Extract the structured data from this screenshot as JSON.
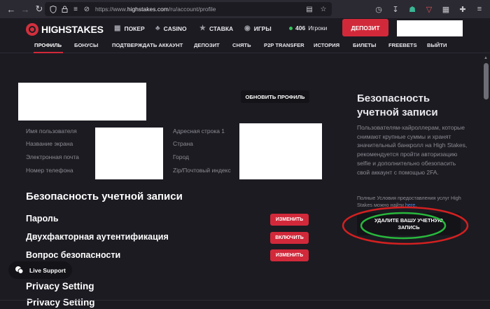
{
  "browser": {
    "url_prefix": "https://www.",
    "url_domain": "highstakes.com",
    "url_path": "/ru/account/profile"
  },
  "site": {
    "logo_text": "HIGHSTAKES",
    "nav": {
      "poker": "ПОКЕР",
      "casino": "CASINO",
      "bet": "СТАВКА",
      "games": "ИГРЫ",
      "online_count": "406",
      "online_label": "Игроки"
    },
    "deposit_button": "ДЕПОЗИТ"
  },
  "subnav": [
    "ПРОФИЛЬ",
    "БОНУСЫ",
    "ПОДТВЕРЖДАТЬ АККАУНТ",
    "ДЕПОЗИТ",
    "СНЯТЬ",
    "P2P TRANSFER",
    "ИСТОРИЯ",
    "БИЛЕТЫ",
    "FREEBETS",
    "ВЫЙТИ"
  ],
  "profile": {
    "update_button": "ОБНОВИТЬ ПРОФИЛЬ",
    "left_labels": [
      "Имя пользователя",
      "Название экрана",
      "Электронная почта",
      "Номер телефона"
    ],
    "right_labels": [
      "Адресная строка 1",
      "Страна",
      "Город",
      "Zip/Почтовый индекс"
    ]
  },
  "security": {
    "title": "Безопасность учетной записи",
    "rows": [
      {
        "label": "Пароль",
        "button": "ИЗМЕНИТЬ"
      },
      {
        "label": "Двухфакторная аутентификация",
        "button": "ВКЛЮЧИТЬ"
      },
      {
        "label": "Вопрос безопасности",
        "button": "ИЗМЕНИТЬ"
      }
    ],
    "privacy_1": "Privacy Setting",
    "privacy_2": "Privacy Setting"
  },
  "sidebar": {
    "title": "Безопасность учетной записи",
    "text": "Пользователям-хайроллерам, которые снимают крупные суммы и хранят значительный банкролл на High Stakes, рекомендуется пройти авторизацию selfie и дополнительно обезопасить свой аккаунт с помощью 2FA.",
    "small_text": "Полные Условия предоставления услуг High Stakes можно найти ",
    "small_link": "here",
    "small_end": ".",
    "delete_button": "УДАЛИТЕ ВАШУ УЧЕТНУЮ ЗАПИСЬ"
  },
  "live_support": "Live Support",
  "colors": {
    "accent_red": "#d2293a",
    "background": "#1c1b22",
    "annotation_red": "#d42020",
    "annotation_green": "#28b83c"
  }
}
